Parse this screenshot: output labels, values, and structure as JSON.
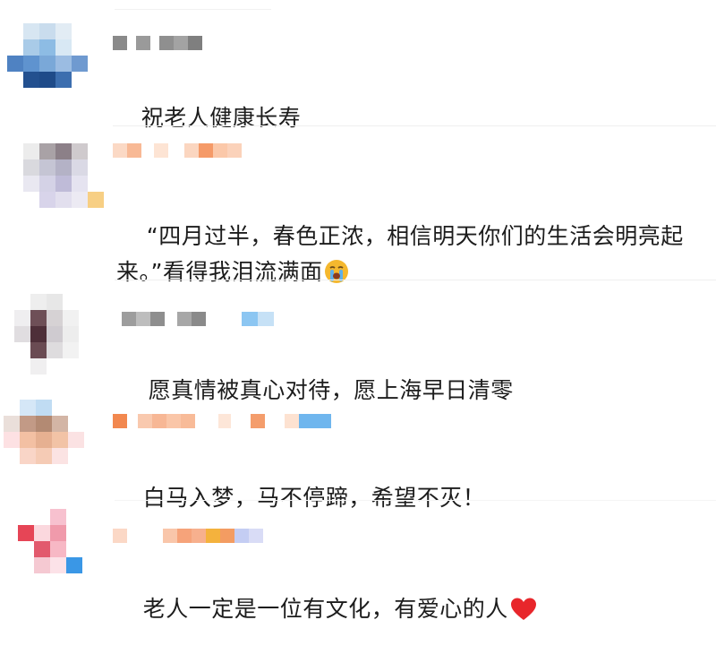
{
  "comments": [
    {
      "text": "祝老人健康长寿",
      "emoji": "",
      "avatar_icon": "pixelated-avatar-icon",
      "username_icon": "pixelated-username-icon"
    },
    {
      "text": "“四月过半，春色正浓，相信明天你们的生活会明亮起来。”看得我泪流满面",
      "emoji": "crying-face-icon",
      "avatar_icon": "pixelated-avatar-icon",
      "username_icon": "pixelated-username-icon"
    },
    {
      "text": "愿真情被真心对待，愿上海早日清零",
      "emoji": "",
      "avatar_icon": "pixelated-avatar-icon",
      "username_icon": "pixelated-username-icon"
    },
    {
      "text": "白马入梦，马不停蹄，希望不灭！",
      "emoji": "",
      "avatar_icon": "pixelated-avatar-icon",
      "username_icon": "pixelated-username-icon"
    },
    {
      "text": "老人一定是一位有文化，有爱心的人",
      "emoji": "red-heart-icon",
      "avatar_icon": "pixelated-avatar-icon",
      "username_icon": "pixelated-username-icon"
    }
  ],
  "colors": {
    "text": "#1c1c1c",
    "separator": "#efefef",
    "heart": "#e8262b",
    "emoji_face": "#f5b82e"
  }
}
